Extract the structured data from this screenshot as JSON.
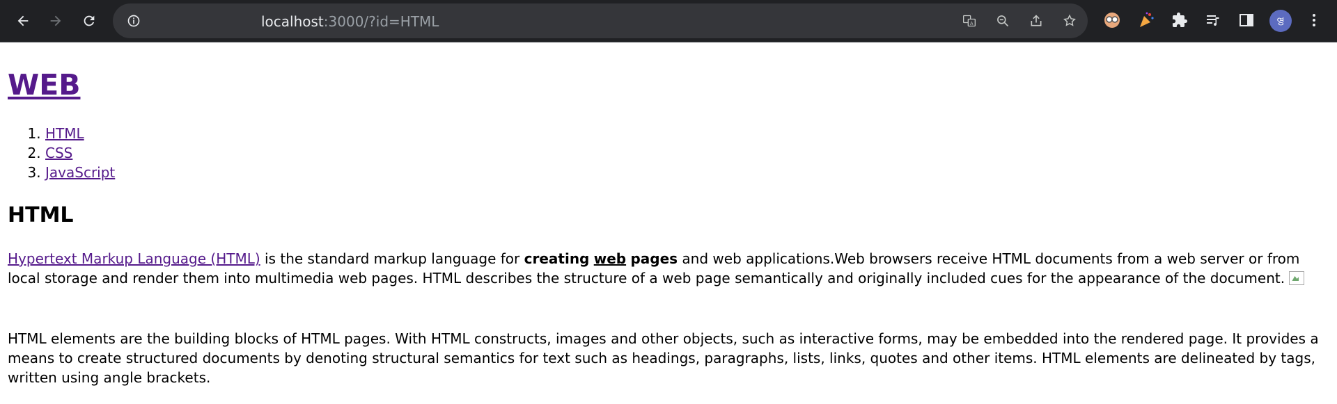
{
  "browser": {
    "url_host": "localhost",
    "url_path": ":3000/?id=HTML",
    "avatar_initial": "영"
  },
  "page": {
    "site_title": "WEB",
    "nav": [
      {
        "label": "HTML"
      },
      {
        "label": "CSS"
      },
      {
        "label": "JavaScript"
      }
    ],
    "heading": "HTML",
    "p1": {
      "link": "Hypertext Markup Language (HTML)",
      "t1": " is the standard markup language for ",
      "bold1": "creating",
      "bold_underline": "web",
      "bold2": "pages",
      "t2": " and web applications.Web browsers receive HTML documents from a web server or from local storage and render them into multimedia web pages. HTML describes the structure of a web page semantically and originally included cues for the appearance of the document. "
    },
    "p2": "HTML elements are the building blocks of HTML pages. With HTML constructs, images and other objects, such as interactive forms, may be embedded into the rendered page. It provides a means to create structured documents by denoting structural semantics for text such as headings, paragraphs, lists, links, quotes and other items. HTML elements are delineated by tags, written using angle brackets."
  }
}
